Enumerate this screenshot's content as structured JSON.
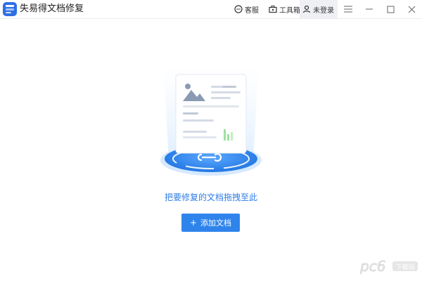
{
  "titlebar": {
    "app_title": "失易得文档修复",
    "kefu_label": "客服",
    "tools_label": "工具箱",
    "login_label": "未登录"
  },
  "main": {
    "drop_hint": "把要修复的文档拖拽至此",
    "add_button_label": "添加文档",
    "add_button_icon": "+"
  },
  "watermark": {
    "logo_text": "pc6",
    "site_text": "下载站"
  },
  "colors": {
    "accent": "#2f84ec",
    "hint_text": "#2f7de6",
    "logo": "#2f6fe4"
  },
  "icons": [
    "app-logo-icon",
    "chat-icon",
    "toolbox-icon",
    "user-icon",
    "menu-icon",
    "minimize-icon",
    "maximize-icon",
    "close-icon",
    "plus-icon"
  ]
}
